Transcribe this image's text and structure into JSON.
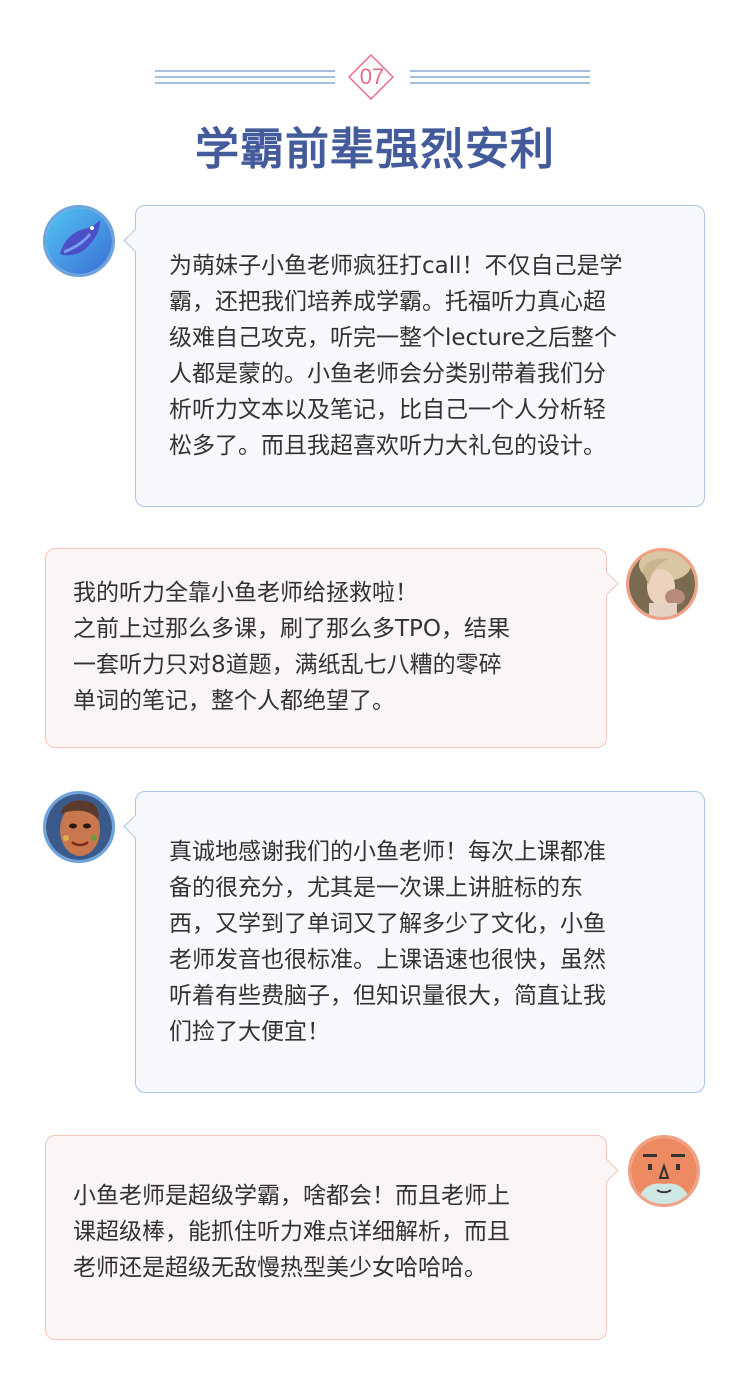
{
  "header": {
    "number": "07",
    "title": "学霸前辈强烈安利"
  },
  "testimonials": [
    {
      "avatar": "bird-avatar-icon",
      "text": "为萌妹子小鱼老师疯狂打call！不仅自己是学\n霸，还把我们培养成学霸。托福听力真心超\n级难自己攻克，听完一整个lecture之后整个\n人都是蒙的。小鱼老师会分类别带着我们分\n析听力文本以及笔记，比自己一个人分析轻\n松多了。而且我超喜欢听力大礼包的设计。"
    },
    {
      "avatar": "woman-portrait-avatar",
      "text": "我的听力全靠小鱼老师给拯救啦！\n之前上过那么多课，刷了那么多TPO，结果\n一套听力只对8道题，满纸乱七八糟的零碎\n单词的笔记，整个人都绝望了。"
    },
    {
      "avatar": "painted-face-avatar",
      "text": "真诚地感谢我们的小鱼老师！每次上课都准\n备的很充分，尤其是一次课上讲脏标的东\n西，又学到了单词又了解多少了文化，小鱼\n老师发音也很标准。上课语速也很快，虽然\n听着有些费脑子，但知识量很大，简直让我\n们捡了大便宜！"
    },
    {
      "avatar": "cartoon-face-avatar",
      "text": "小鱼老师是超级学霸，啥都会！而且老师上\n课超级棒，能抓住听力难点详细解析，而且\n老师还是超级无敌慢热型美少女哈哈哈。"
    }
  ],
  "colors": {
    "title": "#445b9b",
    "accent_pink": "#e86c87",
    "blue_border": "#a9c6ea",
    "pink_border": "#f3c6b7"
  }
}
